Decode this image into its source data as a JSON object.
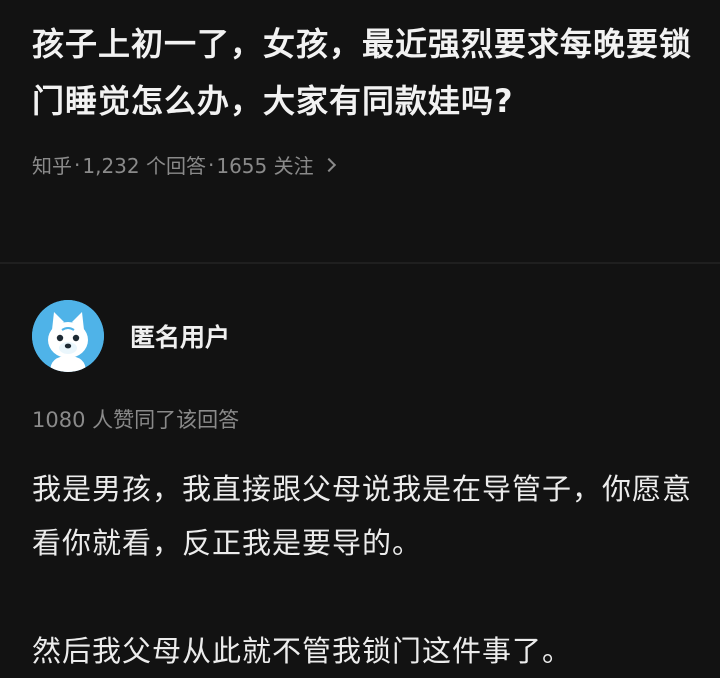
{
  "question": {
    "title": "孩子上初一了，女孩，最近强烈要求每晚要锁门睡觉怎么办，大家有同款娃吗?",
    "source": "知乎",
    "dot": "·",
    "answers_count": "1,232 个回答",
    "followers_count": "1655 关注"
  },
  "answer": {
    "author_name": "匿名用户",
    "likes_text": "1080 人赞同了该回答",
    "paragraphs": [
      "我是男孩，我直接跟父母说我是在导管子，你愿意看你就看，反正我是要导的。",
      "然后我父母从此就不管我锁门这件事了。"
    ]
  },
  "colors": {
    "background": "#121212",
    "title_text": "#f2f2f2",
    "meta_text": "#8a8a8a",
    "avatar_bg": "#4fb3e8"
  },
  "icons": {
    "avatar": "anonymous-mascot-avatar",
    "chevron": "chevron-right-icon"
  }
}
